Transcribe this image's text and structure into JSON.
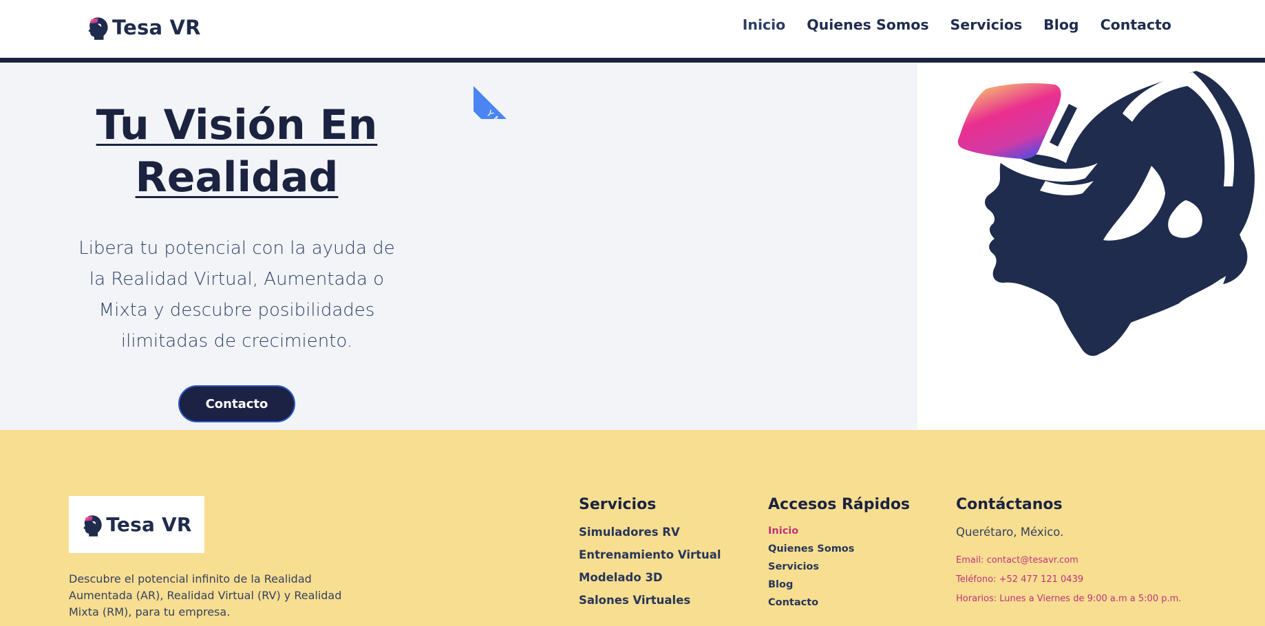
{
  "header": {
    "brand": "Tesa VR",
    "nav": [
      "Inicio",
      "Quienes Somos",
      "Servicios",
      "Blog",
      "Contacto"
    ]
  },
  "hero": {
    "title_line1": "Tu Visión En",
    "title_line2": "Realidad",
    "ribbon": "Y MÁs",
    "subtitle": "Libera tu potencial con la ayuda de la Realidad Virtual, Aumentada o Mixta y descubre posibilidades ilimitadas de crecimiento.",
    "cta": "Contacto"
  },
  "footer": {
    "brand": "Tesa VR",
    "description": "Descubre el potencial infinito de la Realidad Aumentada (AR), Realidad Virtual (RV) y Realidad Mixta (RM), para tu empresa.",
    "services": {
      "title": "Servicios",
      "items": [
        "Simuladores RV",
        "Entrenamiento Virtual",
        "Modelado 3D",
        "Salones Virtuales"
      ]
    },
    "quick_links": {
      "title": "Accesos Rápidos",
      "items": [
        "Inicio",
        "Quienes Somos",
        "Servicios",
        "Blog",
        "Contacto"
      ]
    },
    "contact": {
      "title": "Contáctanos",
      "address": "Querétaro, México.",
      "email": "Email: contact@tesavr.com",
      "phone": "Teléfono: +52 477 121 0439",
      "hours": "Horarios: Lunes a Viernes de 9:00 a.m a 5:00 p.m."
    }
  },
  "colors": {
    "navy": "#1c2340",
    "hero_bg": "#f2f4f8",
    "footer_bg": "#f7de91",
    "accent_pink": "#c2327d",
    "ribbon_blue": "#4a85f2"
  },
  "icons": {
    "brand_logo": "vr-headset-head-icon",
    "hero_illustration": "vr-headset-head-illustration"
  }
}
